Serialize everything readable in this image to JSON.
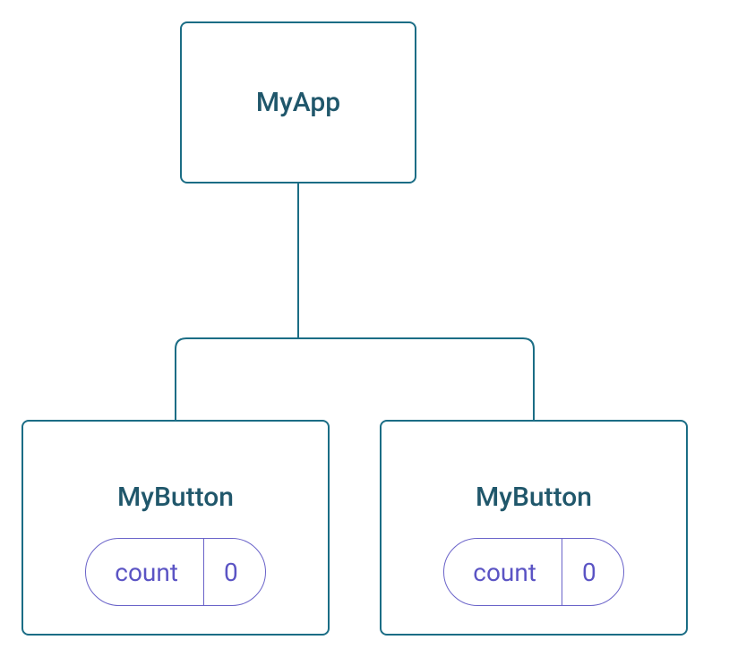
{
  "root": {
    "title": "MyApp"
  },
  "children": [
    {
      "title": "MyButton",
      "state": {
        "label": "count",
        "value": "0"
      }
    },
    {
      "title": "MyButton",
      "state": {
        "label": "count",
        "value": "0"
      }
    }
  ]
}
